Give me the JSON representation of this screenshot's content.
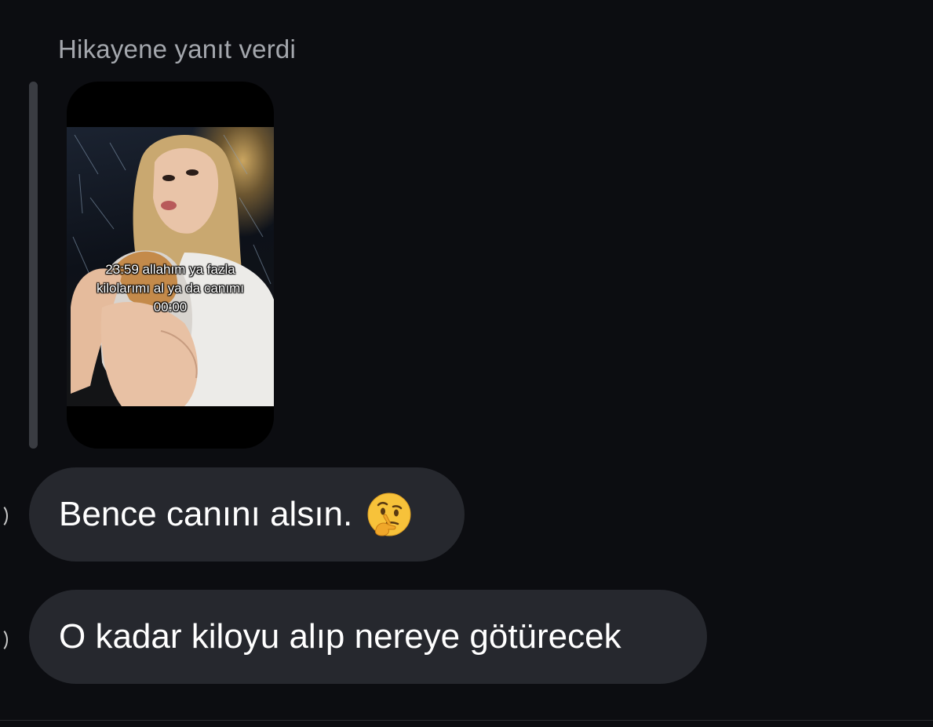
{
  "reply_header": {
    "label": "Hikayene yanıt verdi"
  },
  "story": {
    "caption_lines": [
      "23:59 allahım ya fazla",
      "kilolarımı al ya da canımı",
      "00:00"
    ]
  },
  "messages": [
    {
      "text": "Bence canını alsın.",
      "emoji": "thinking-face-icon"
    },
    {
      "text": "O kadar kiloyu alıp nereye götürecek"
    }
  ],
  "colors": {
    "background": "#0c0d11",
    "bubble": "#26282e",
    "label": "#a4a7ad",
    "quote_bar": "#3a3c42"
  }
}
